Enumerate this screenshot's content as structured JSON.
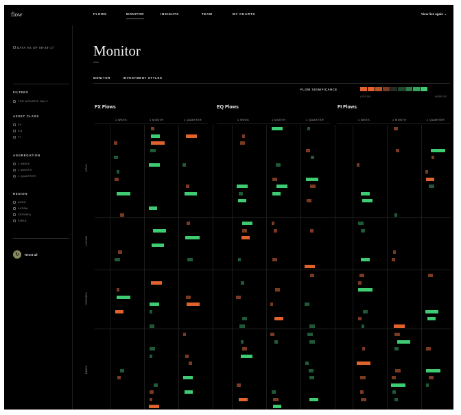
{
  "app": {
    "logo_text": "flow"
  },
  "nav": {
    "items": [
      "FLOWS",
      "MONITOR",
      "INSIGHTS",
      "TEAM",
      "MY CHARTS"
    ],
    "active": "MONITOR",
    "user_label": "View live again"
  },
  "sidebar": {
    "as_of": "DATA AS OF 08-28-17",
    "filters_label": "FILTERS",
    "filters_option": "TOP MOVERS ONLY",
    "asset_class_label": "ASSET CLASS",
    "asset_class_options": [
      "FX",
      "EQ",
      "FI"
    ],
    "aggregation_label": "AGGREGATION",
    "aggregation_options": [
      "1 WEEK",
      "1 MONTH",
      "1 QUARTER"
    ],
    "region_label": "REGION",
    "region_options": [
      "APAC",
      "LATAM",
      "CEEMEA",
      "EMEA"
    ],
    "reset_label": "Reset all"
  },
  "main": {
    "title": "Monitor",
    "subtabs": [
      "MONITOR",
      "INVESTMENT STYLES"
    ],
    "significance_label": "FLOW SIGNIFICANCE",
    "legend_colors": [
      "#e0622c",
      "#e0622c",
      "#b9542a",
      "#7a3a22",
      "#2a2a2a",
      "#1f4a30",
      "#2f7a49",
      "#36a65f",
      "#3ecb72"
    ],
    "legend_low": "LESS SIG",
    "legend_high": "MORE SIG",
    "sections": [
      "FX Flows",
      "EQ Flows",
      "FI Flows"
    ],
    "column_headers": [
      "1 WEEK",
      "1 MONTH",
      "1 QUARTER"
    ],
    "groups": [
      "APAC",
      "LATAM",
      "CEEMEA",
      "EMEA"
    ]
  },
  "colors": {
    "sell_strong": "#e0622c",
    "sell_weak": "#7a3a22",
    "buy_strong": "#3ecb72",
    "buy_weak": "#1f5a38"
  }
}
